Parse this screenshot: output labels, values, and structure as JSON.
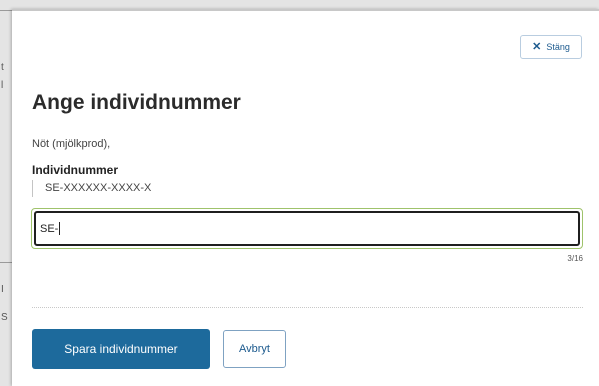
{
  "background": {
    "edge_chars": [
      "t",
      "l",
      "I",
      "S"
    ]
  },
  "dialog": {
    "close_label": "Stäng",
    "close_icon": "close-icon",
    "title": "Ange individnummer",
    "subtitle": "Nöt (mjölkprod),",
    "field": {
      "label": "Individnummer",
      "hint": "SE-XXXXXX-XXXX-X",
      "value": "SE-",
      "char_count": "3/16"
    },
    "buttons": {
      "save_label": "Spara individnummer",
      "cancel_label": "Avbryt"
    }
  },
  "colors": {
    "primary": "#1d6a9c",
    "link": "#1c5a8e",
    "focus_outer": "#9fc36b"
  }
}
